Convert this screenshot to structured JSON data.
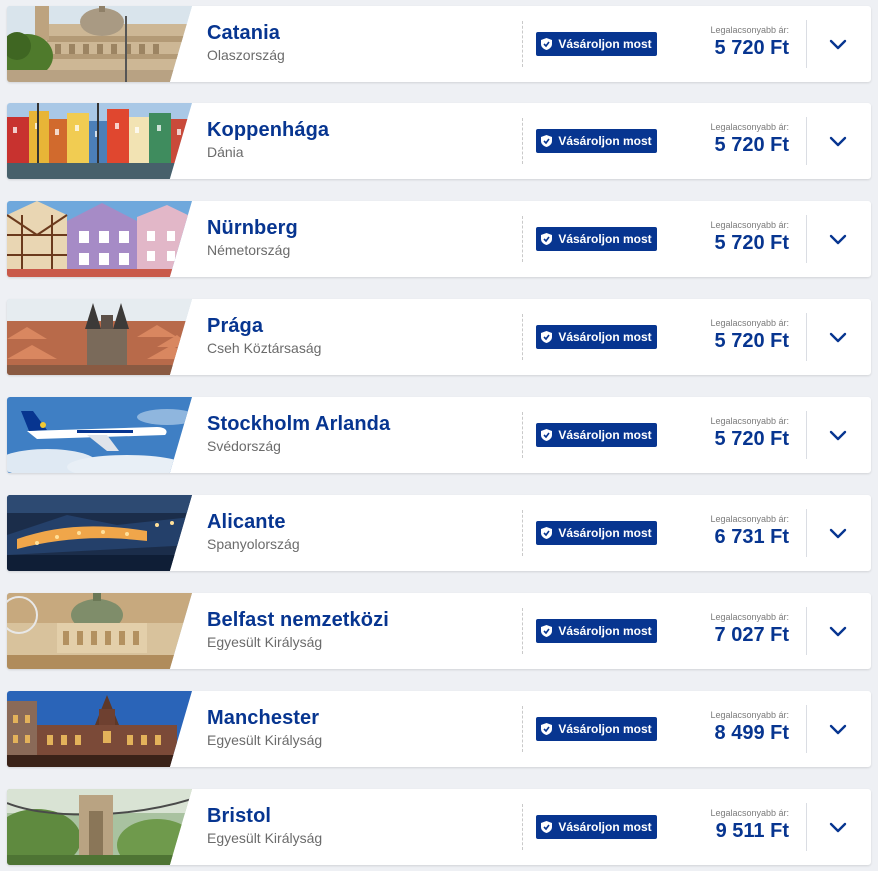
{
  "destinations": [
    {
      "city": "Catania",
      "country": "Olaszország",
      "buy_label": "Vásároljon most",
      "price_label": "Legalacsonyabb ár:",
      "price": "5 720 Ft",
      "image": "catania-cathedral-photo"
    },
    {
      "city": "Koppenhága",
      "country": "Dánia",
      "buy_label": "Vásároljon most",
      "price_label": "Legalacsonyabb ár:",
      "price": "5 720 Ft",
      "image": "copenhagen-nyhavn-photo"
    },
    {
      "city": "Nürnberg",
      "country": "Németország",
      "buy_label": "Vásároljon most",
      "price_label": "Legalacsonyabb ár:",
      "price": "5 720 Ft",
      "image": "nuremberg-houses-photo"
    },
    {
      "city": "Prága",
      "country": "Cseh Köztársaság",
      "buy_label": "Vásároljon most",
      "price_label": "Legalacsonyabb ár:",
      "price": "5 720 Ft",
      "image": "prague-church-photo"
    },
    {
      "city": "Stockholm Arlanda",
      "country": "Svédország",
      "buy_label": "Vásároljon most",
      "price_label": "Legalacsonyabb ár:",
      "price": "5 720 Ft",
      "image": "ryanair-plane-photo"
    },
    {
      "city": "Alicante",
      "country": "Spanyolország",
      "buy_label": "Vásároljon most",
      "price_label": "Legalacsonyabb ár:",
      "price": "6 731 Ft",
      "image": "alicante-harbor-night-photo"
    },
    {
      "city": "Belfast nemzetközi",
      "country": "Egyesült Királyság",
      "buy_label": "Vásároljon most",
      "price_label": "Legalacsonyabb ár:",
      "price": "7 027 Ft",
      "image": "belfast-city-hall-photo"
    },
    {
      "city": "Manchester",
      "country": "Egyesült Királyság",
      "buy_label": "Vásároljon most",
      "price_label": "Legalacsonyabb ár:",
      "price": "8 499 Ft",
      "image": "manchester-town-hall-photo"
    },
    {
      "city": "Bristol",
      "country": "Egyesült Királyság",
      "buy_label": "Vásároljon most",
      "price_label": "Legalacsonyabb ár:",
      "price": "9 511 Ft",
      "image": "bristol-suspension-bridge-photo"
    }
  ],
  "colors": {
    "brand": "#073590",
    "accent": "#f1c933",
    "muted": "#6b6b6b",
    "background": "#eef0f4"
  },
  "icons": {
    "buy": "shield-check-icon",
    "expand": "chevron-down-icon"
  }
}
